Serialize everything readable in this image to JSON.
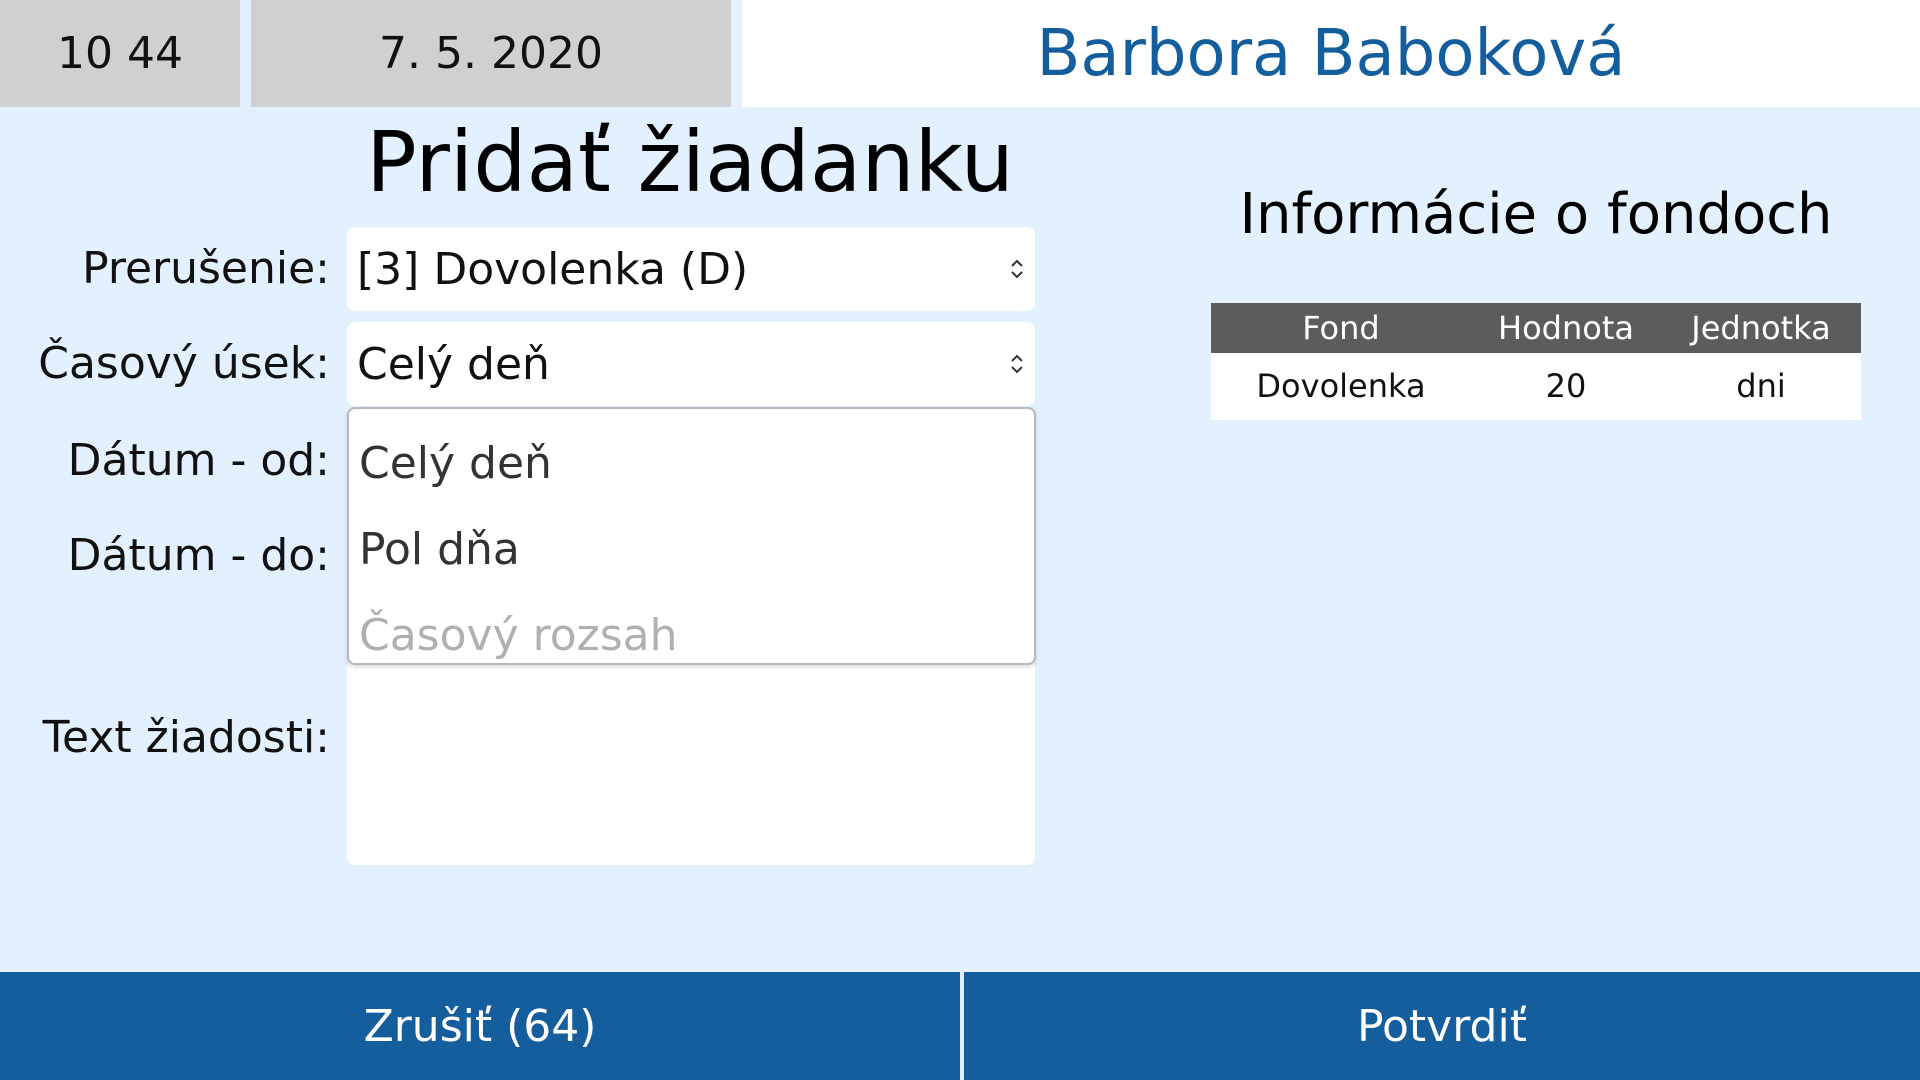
{
  "header": {
    "time": "10 44",
    "date": "7. 5. 2020",
    "user_name": "Barbora Baboková"
  },
  "page": {
    "title": "Pridať žiadanku"
  },
  "form": {
    "interruption": {
      "label": "Prerušenie:",
      "value": "[3] Dovolenka (D)"
    },
    "time_section": {
      "label": "Časový úsek:",
      "value": "Celý deň",
      "options": [
        {
          "label": "Celý deň",
          "disabled": false
        },
        {
          "label": "Pol dňa",
          "disabled": false
        },
        {
          "label": "Časový rozsah",
          "disabled": true
        }
      ]
    },
    "date_from": {
      "label": "Dátum - od:"
    },
    "date_to": {
      "label": "Dátum - do:"
    },
    "request_text": {
      "label": "Text žiadosti:",
      "value": ""
    }
  },
  "funds": {
    "title": "Informácie o fondoch",
    "columns": [
      "Fond",
      "Hodnota",
      "Jednotka"
    ],
    "rows": [
      [
        "Dovolenka",
        "20",
        "dni"
      ]
    ]
  },
  "footer": {
    "cancel_label": "Zrušiť (64)",
    "confirm_label": "Potvrdiť"
  },
  "colors": {
    "background": "#e3f0fe",
    "accent": "#145e9e",
    "header_gray": "#d0d0d0",
    "table_header": "#5c5c5c"
  }
}
